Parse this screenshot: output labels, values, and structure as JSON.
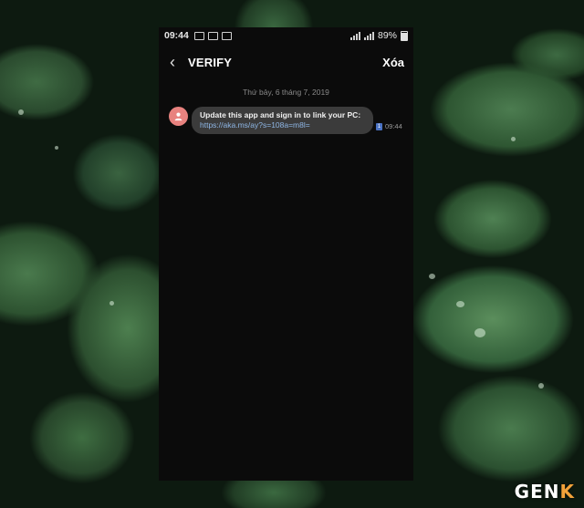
{
  "status_bar": {
    "time": "09:44",
    "battery": "89%"
  },
  "app_bar": {
    "back_icon": "chevron-left-icon",
    "title": "VERIFY",
    "delete_label": "Xóa"
  },
  "conversation": {
    "date": "Thứ bảy, 6 tháng 7, 2019",
    "messages": [
      {
        "text": "Update this app and sign in to link your PC:",
        "link": "https://aka.ms/ay?s=108a=m8l=",
        "sim": "1",
        "time": "09:44"
      }
    ]
  },
  "watermark": {
    "main": "GEN",
    "accent": "K"
  },
  "colors": {
    "avatar": "#e8827f",
    "bubble": "#3b3b3b",
    "link": "#8fb7e6",
    "sim_badge": "#4b73c4",
    "watermark_accent": "#f2a23a"
  }
}
